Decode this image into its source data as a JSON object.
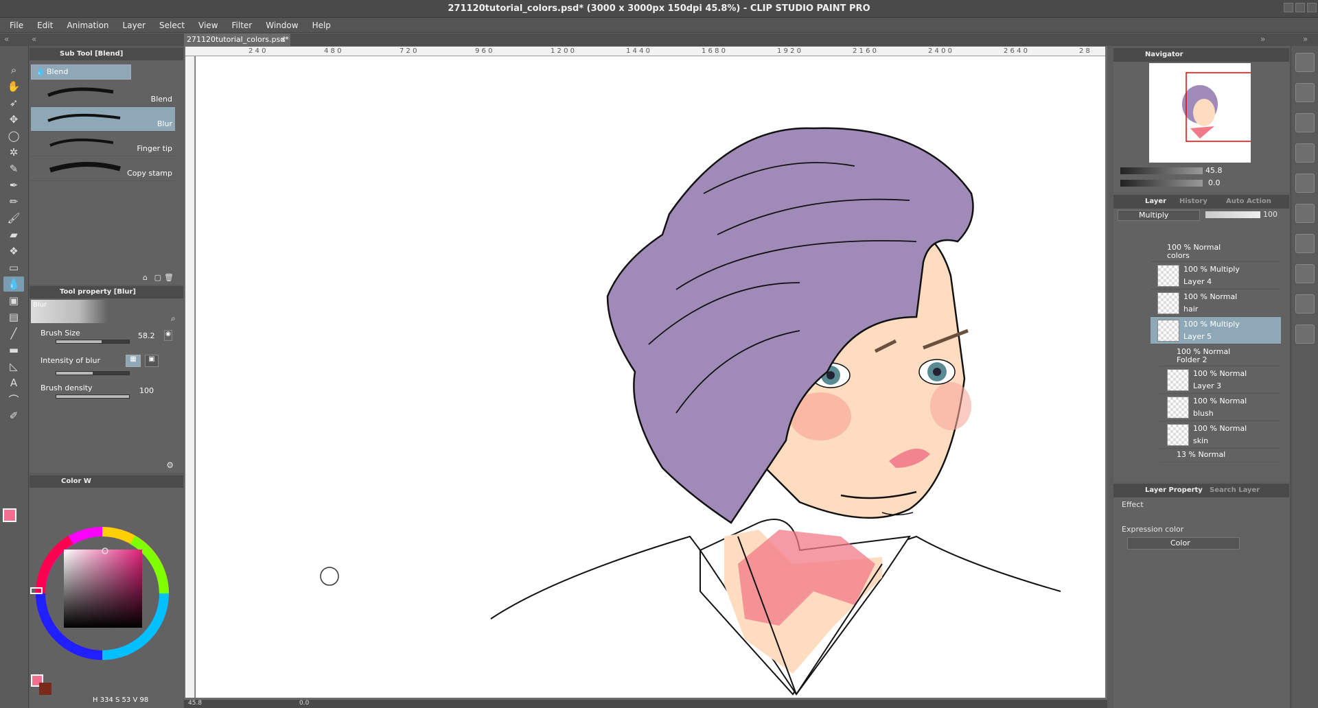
{
  "window": {
    "title": "271120tutorial_colors.psd* (3000 x 3000px 150dpi 45.8%)  - CLIP STUDIO PAINT PRO"
  },
  "menu": [
    "File",
    "Edit",
    "Animation",
    "Layer",
    "Select",
    "View",
    "Filter",
    "Window",
    "Help"
  ],
  "doc_tab": "271120tutorial_colors.psd*",
  "subtool": {
    "panel_title": "Sub Tool [Blend]",
    "group_tab": "Blend",
    "brushes": [
      "Blend",
      "Blur",
      "Finger tip",
      "Copy stamp"
    ]
  },
  "toolprop": {
    "panel_title": "Tool property [Blur]",
    "preview_label": "Blur",
    "brush_size_label": "Brush Size",
    "brush_size_value": "58.2",
    "brush_size_fraction": 0.62,
    "intensity_label": "Intensity of blur",
    "intensity_fraction": 0.5,
    "density_label": "Brush density",
    "density_value": "100",
    "density_fraction": 1.0
  },
  "color": {
    "panel_tab": "Color W",
    "h": "334",
    "s": "53",
    "v": "98",
    "h_label": "H",
    "s_label": "S",
    "v_label": "V",
    "main_color": "#f2708f",
    "sub_color": "#7a2a1a"
  },
  "ruler_ticks": [
    "2 4 0",
    "4 8 0",
    "7 2 0",
    "9 6 0",
    "1 2 0 0",
    "1 4 4 0",
    "1 6 8 0",
    "1 9 2 0",
    "2 1 6 0",
    "2 4 0 0",
    "2 6 4 0",
    "2 8"
  ],
  "status": {
    "zoom": "45.8",
    "angle": "0.0"
  },
  "navigator": {
    "tab": "Navigator",
    "zoom": "45.8",
    "angle": "0.0"
  },
  "layer_panel": {
    "tabs": [
      "Layer",
      "History",
      "Auto Action"
    ],
    "blend_mode": "Multiply",
    "opacity": "100",
    "layers": [
      {
        "blend": "100 % Normal",
        "name": "colors",
        "type": "folder"
      },
      {
        "blend": "100 % Multiply",
        "name": "Layer 4"
      },
      {
        "blend": "100 % Normal",
        "name": "hair"
      },
      {
        "blend": "100 % Multiply",
        "name": "Layer 5",
        "selected": true
      },
      {
        "blend": "100 % Normal",
        "name": "Folder 2",
        "type": "folder"
      },
      {
        "blend": "100 % Normal",
        "name": "Layer 3"
      },
      {
        "blend": "100 % Normal",
        "name": "blush"
      },
      {
        "blend": "100 % Normal",
        "name": "skin"
      },
      {
        "blend": "13 % Normal",
        "name": "",
        "type": "folder"
      }
    ]
  },
  "layer_property": {
    "tabs": [
      "Layer Property",
      "Search Layer"
    ],
    "effect_label": "Effect",
    "expression_label": "Expression color",
    "expression_value": "Color"
  },
  "colors": {
    "hair": "#a08ab8",
    "skin": "#fddcc0",
    "blush": "#f07a88",
    "eye": "#5a8a94",
    "accent": "#8fa8b8"
  }
}
